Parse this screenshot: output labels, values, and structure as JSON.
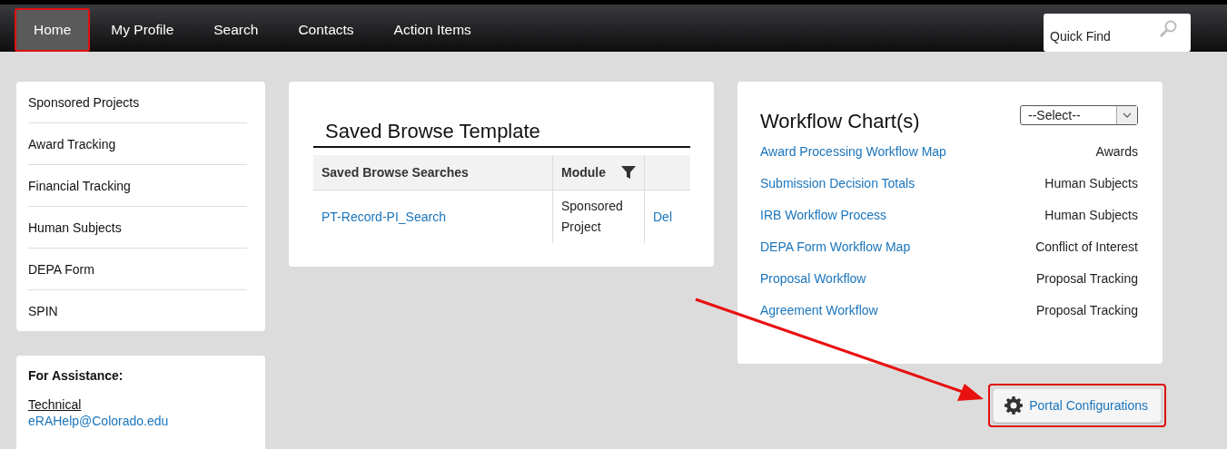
{
  "nav": {
    "tabs": [
      {
        "label": "Home",
        "selected": true,
        "highlighted": true
      },
      {
        "label": "My Profile",
        "selected": false,
        "highlighted": false
      },
      {
        "label": "Search",
        "selected": false,
        "highlighted": false
      },
      {
        "label": "Contacts",
        "selected": false,
        "highlighted": false
      },
      {
        "label": "Action Items",
        "selected": false,
        "highlighted": false
      }
    ],
    "quick_find": {
      "placeholder": "Quick Find"
    }
  },
  "sidebar": {
    "items": [
      "Sponsored Projects",
      "Award Tracking",
      "Financial Tracking",
      "Human Subjects",
      "DEPA Form",
      "SPIN"
    ]
  },
  "assistance": {
    "title": "For Assistance:",
    "label": "Technical",
    "email": "eRAHelp@Colorado.edu"
  },
  "saved_browse": {
    "title": "Saved Browse Template",
    "columns": [
      "Saved Browse Searches",
      "Module"
    ],
    "rows": [
      {
        "search": "PT-Record-PI_Search",
        "module": "Sponsored Project",
        "action": "Del"
      }
    ]
  },
  "workflow": {
    "title": "Workflow Chart(s)",
    "select": {
      "value": "--Select--"
    },
    "items": [
      {
        "name": "Award Processing Workflow Map",
        "module": "Awards"
      },
      {
        "name": "Submission Decision Totals",
        "module": "Human Subjects"
      },
      {
        "name": "IRB Workflow Process",
        "module": "Human Subjects"
      },
      {
        "name": "DEPA Form Workflow Map",
        "module": "Conflict of Interest"
      },
      {
        "name": "Proposal Workflow",
        "module": "Proposal Tracking"
      },
      {
        "name": "Agreement Workflow",
        "module": "Proposal Tracking"
      }
    ]
  },
  "portal_button": {
    "label": "Portal Configurations",
    "highlighted": true
  }
}
